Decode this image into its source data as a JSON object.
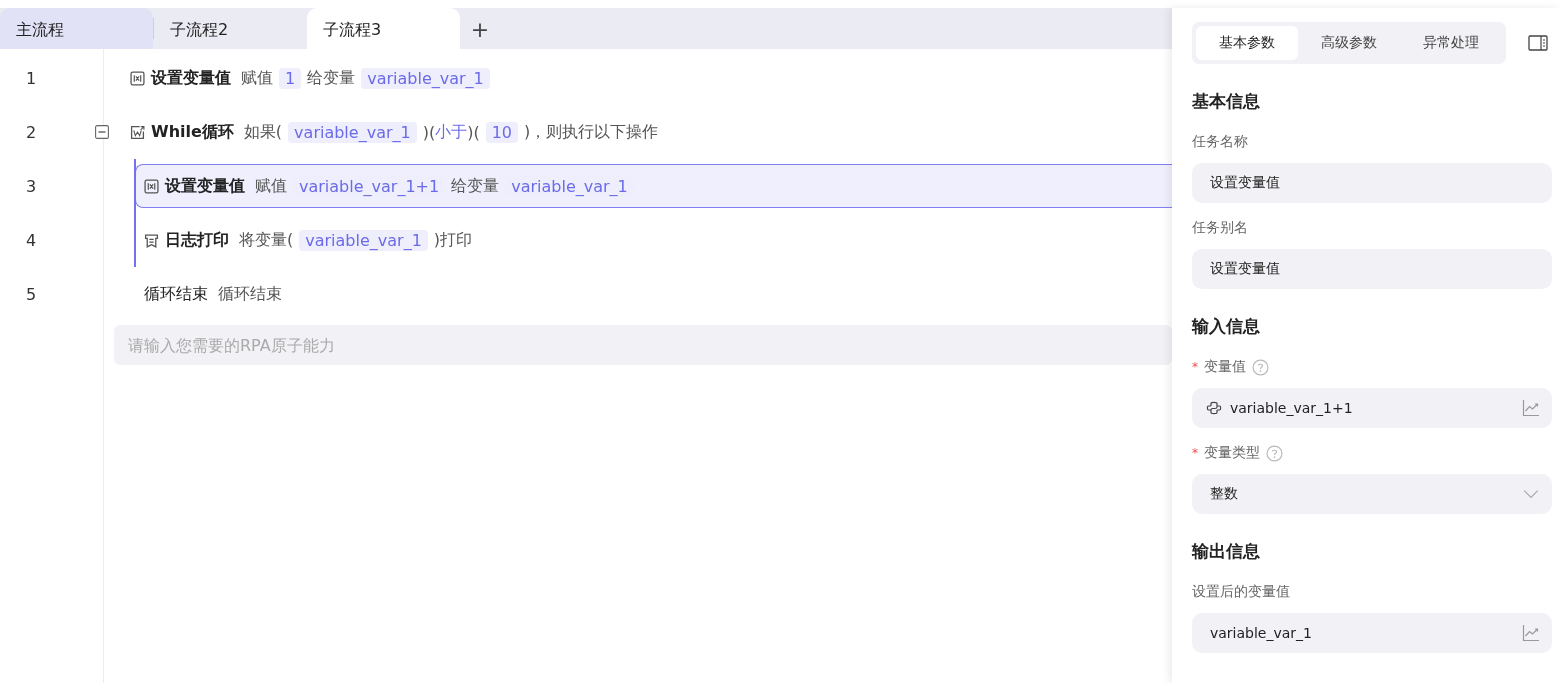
{
  "tabs": [
    {
      "label": "主流程",
      "selected": false,
      "kind": "main"
    },
    {
      "label": "子流程2",
      "selected": false,
      "kind": "sub"
    },
    {
      "label": "子流程3",
      "selected": true,
      "kind": "sub"
    }
  ],
  "add_tab": "+",
  "lines": [
    {
      "number": "1",
      "kind": "set",
      "title": "设置变量值",
      "selected": false,
      "parts": [
        {
          "kind": "text",
          "text": "赋值"
        },
        {
          "kind": "token",
          "text": "1"
        },
        {
          "kind": "text",
          "text": "给变量"
        },
        {
          "kind": "token",
          "text": "variable_var_1"
        }
      ]
    },
    {
      "number": "2",
      "kind": "while",
      "title": "While循环",
      "selected": false,
      "expanded": true,
      "parts": [
        {
          "kind": "text",
          "text": "如果("
        },
        {
          "kind": "token",
          "text": "variable_var_1"
        },
        {
          "kind": "text",
          "text": ")("
        },
        {
          "kind": "op",
          "text": "小于"
        },
        {
          "kind": "text",
          "text": ")("
        },
        {
          "kind": "token",
          "text": "10"
        },
        {
          "kind": "text",
          "text": ")，则执行以下操作"
        }
      ],
      "children": [
        {
          "number": "3",
          "kind": "set",
          "title": "设置变量值",
          "selected": true,
          "parts": [
            {
              "kind": "text",
              "text": "赋值"
            },
            {
              "kind": "token",
              "text": "variable_var_1+1"
            },
            {
              "kind": "text",
              "text": "给变量"
            },
            {
              "kind": "token",
              "text": "variable_var_1"
            }
          ]
        },
        {
          "number": "4",
          "kind": "log",
          "title": "日志打印",
          "selected": false,
          "parts": [
            {
              "kind": "text",
              "text": "将变量("
            },
            {
              "kind": "token",
              "text": "variable_var_1"
            },
            {
              "kind": "text",
              "text": ")打印"
            }
          ]
        }
      ]
    },
    {
      "number": "5",
      "kind": "end",
      "title": "循环结束",
      "selected": false,
      "parts": [
        {
          "kind": "text",
          "text": "循环结束"
        }
      ]
    }
  ],
  "command_input": {
    "placeholder": "请输入您需要的RPA原子能力"
  },
  "panel": {
    "tabs": [
      {
        "label": "基本参数",
        "selected": true
      },
      {
        "label": "高级参数",
        "selected": false
      },
      {
        "label": "异常处理",
        "selected": false
      }
    ],
    "sections": [
      {
        "title": "基本信息",
        "fields": [
          {
            "label": "任务名称",
            "help": false,
            "kind": "text",
            "value": "设置变量值"
          },
          {
            "label": "任务别名",
            "help": false,
            "kind": "text",
            "value": "设置变量值"
          }
        ]
      },
      {
        "title": "输入信息",
        "fields": [
          {
            "label": "变量值",
            "required_mark": "*",
            "help": true,
            "kind": "expression",
            "value": "variable_var_1+1"
          },
          {
            "label": "变量类型",
            "required_mark": "*",
            "help": true,
            "kind": "select",
            "value": "整数"
          }
        ]
      },
      {
        "title": "输出信息",
        "fields": [
          {
            "label": "设置后的变量值",
            "help": false,
            "kind": "variable",
            "value": "variable_var_1"
          }
        ]
      }
    ]
  }
}
